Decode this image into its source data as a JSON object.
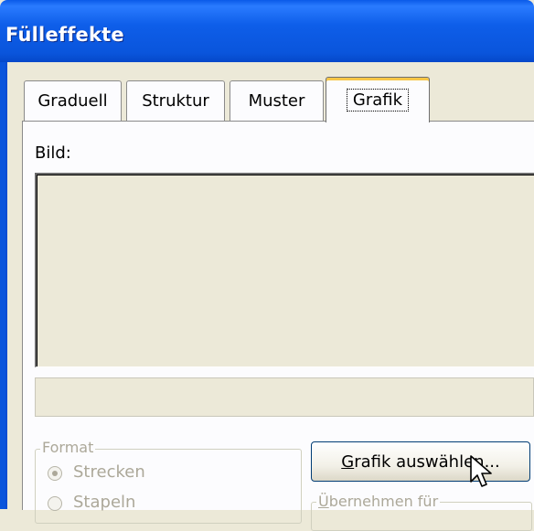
{
  "window": {
    "title": "Fülleffekte"
  },
  "tabs": [
    {
      "label": "Graduell",
      "active": false
    },
    {
      "label": "Struktur",
      "active": false
    },
    {
      "label": "Muster",
      "active": false
    },
    {
      "label": "Grafik",
      "active": true
    }
  ],
  "panel": {
    "picture_label": "Bild:",
    "format_group": {
      "label": "Format",
      "options": [
        {
          "label": "Strecken",
          "checked": true,
          "enabled": false
        },
        {
          "label": "Stapeln",
          "checked": false,
          "enabled": false
        }
      ]
    },
    "select_button": {
      "prefix": "G",
      "rest": "rafik auswählen..."
    },
    "apply_group": {
      "prefix": "Ü",
      "rest": "bernehmen für"
    }
  },
  "colors": {
    "titlebar": "#0A55DC",
    "dialog_bg": "#ECE9D8",
    "panel_bg": "#FCFCFE",
    "tab_highlight": "#F7C646"
  }
}
